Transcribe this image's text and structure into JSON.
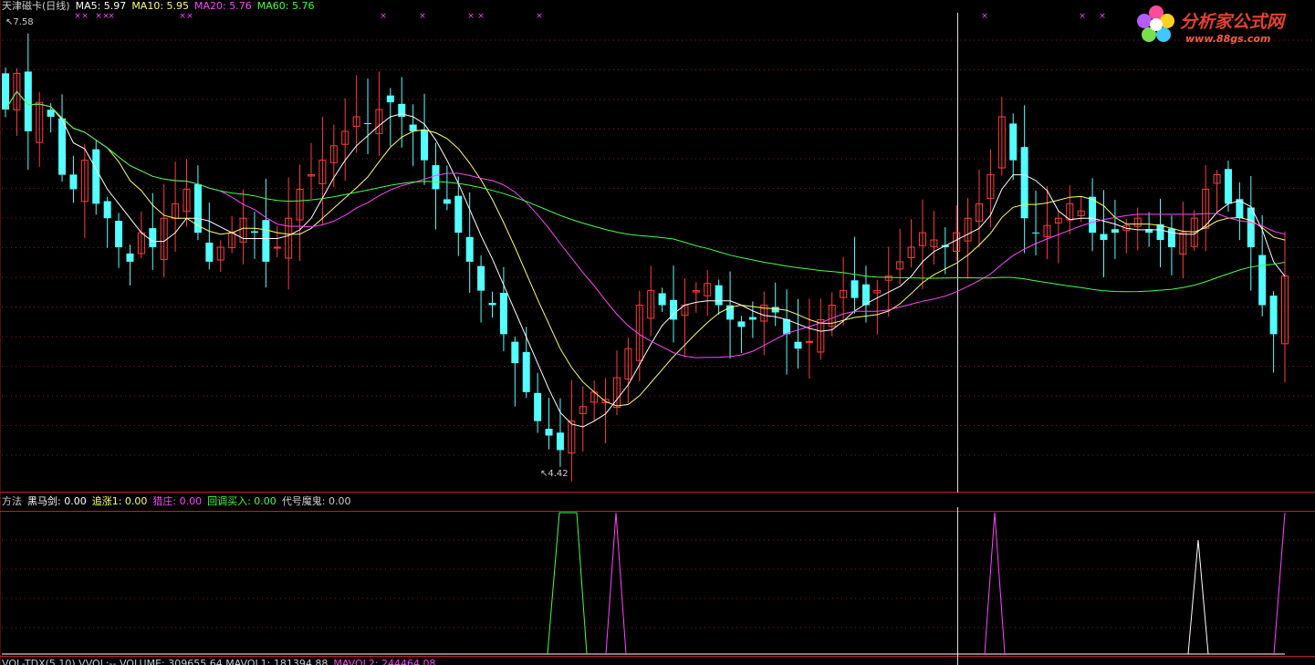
{
  "main_header": {
    "title": "天津磁卡(日线)",
    "ma5": "MA5: 5.97",
    "ma10": "MA10: 5.95",
    "ma20": "MA20: 5.76",
    "ma60": "MA60: 5.76"
  },
  "price_marks": {
    "high": "7.58",
    "low": "4.42"
  },
  "indicator_header": {
    "method": "方法",
    "heima": "黑马剑: 0.00",
    "zhuizhang": "追涨1: 0.00",
    "liezhuang": "猎庄: 0.00",
    "huidiao": "回调买入: 0.00",
    "daihao": "代号魔鬼: 0.00"
  },
  "volume_header": {
    "text": "VOL-TDX(5,10)  VVOL:--  VOLUME: 309655.64  MAVOL1: 181394.88",
    "mavol2": "MAVOL2: 244464.08"
  },
  "logo": {
    "title": "分析家公式网",
    "url": "www.88gs.com"
  },
  "colors": {
    "up": "#ff3c3c",
    "down": "#54ffff",
    "ma5": "#ffffff",
    "ma10": "#ffff66",
    "ma20": "#ff44ff",
    "ma60": "#44ff44",
    "grid": "#8a1a1a",
    "marker": "#ff44ff"
  },
  "chart_data": [
    {
      "type": "candlestick",
      "title": "天津磁卡(日线)",
      "price_range": [
        4.42,
        7.58
      ],
      "candles_close": [
        6.95,
        7.2,
        6.8,
        7.0,
        6.9,
        6.5,
        6.4,
        6.6,
        6.3,
        6.2,
        6.0,
        5.9,
        6.1,
        6.0,
        6.2,
        6.3,
        6.4,
        6.1,
        5.9,
        6.0,
        6.1,
        6.2,
        6.1,
        5.9,
        6.0,
        6.2,
        6.4,
        6.5,
        6.6,
        6.7,
        6.8,
        6.9,
        6.85,
        6.95,
        7.0,
        6.9,
        6.8,
        6.6,
        6.4,
        6.3,
        6.1,
        5.9,
        5.7,
        5.6,
        5.4,
        5.2,
        5.0,
        4.8,
        4.7,
        4.6,
        4.8,
        4.9,
        5.0,
        4.95,
        5.1,
        5.3,
        5.6,
        5.7,
        5.6,
        5.5,
        5.6,
        5.7,
        5.75,
        5.6,
        5.5,
        5.45,
        5.5,
        5.6,
        5.55,
        5.4,
        5.3,
        5.35,
        5.5,
        5.6,
        5.7,
        5.65,
        5.6,
        5.7,
        5.8,
        5.9,
        6.0,
        6.1,
        6.05,
        6.0,
        6.1,
        6.2,
        6.3,
        6.5,
        6.9,
        6.6,
        6.2,
        6.1,
        6.15,
        6.2,
        6.3,
        6.25,
        6.1,
        6.05,
        6.1,
        6.15,
        6.2,
        6.1,
        6.05,
        6.0,
        6.1,
        6.2,
        6.4,
        6.5,
        6.3,
        6.2,
        6.0,
        5.6,
        5.4,
        5.8
      ]
    },
    {
      "type": "line",
      "series": [
        {
          "name": "黑马剑",
          "values": [
            0,
            0,
            0,
            0,
            0,
            0,
            0,
            0
          ]
        },
        {
          "name": "追涨1",
          "values": [
            0,
            0,
            0,
            0,
            0,
            0,
            0,
            0
          ]
        },
        {
          "name": "猎庄",
          "values": [
            0,
            0,
            0,
            0,
            0,
            0,
            0,
            0
          ]
        },
        {
          "name": "回调买入",
          "values": [
            0,
            0,
            0,
            0,
            0,
            0,
            0,
            0
          ]
        },
        {
          "name": "代号魔鬼",
          "values": [
            0,
            0,
            0,
            0,
            0,
            0,
            0,
            0
          ]
        }
      ]
    }
  ]
}
